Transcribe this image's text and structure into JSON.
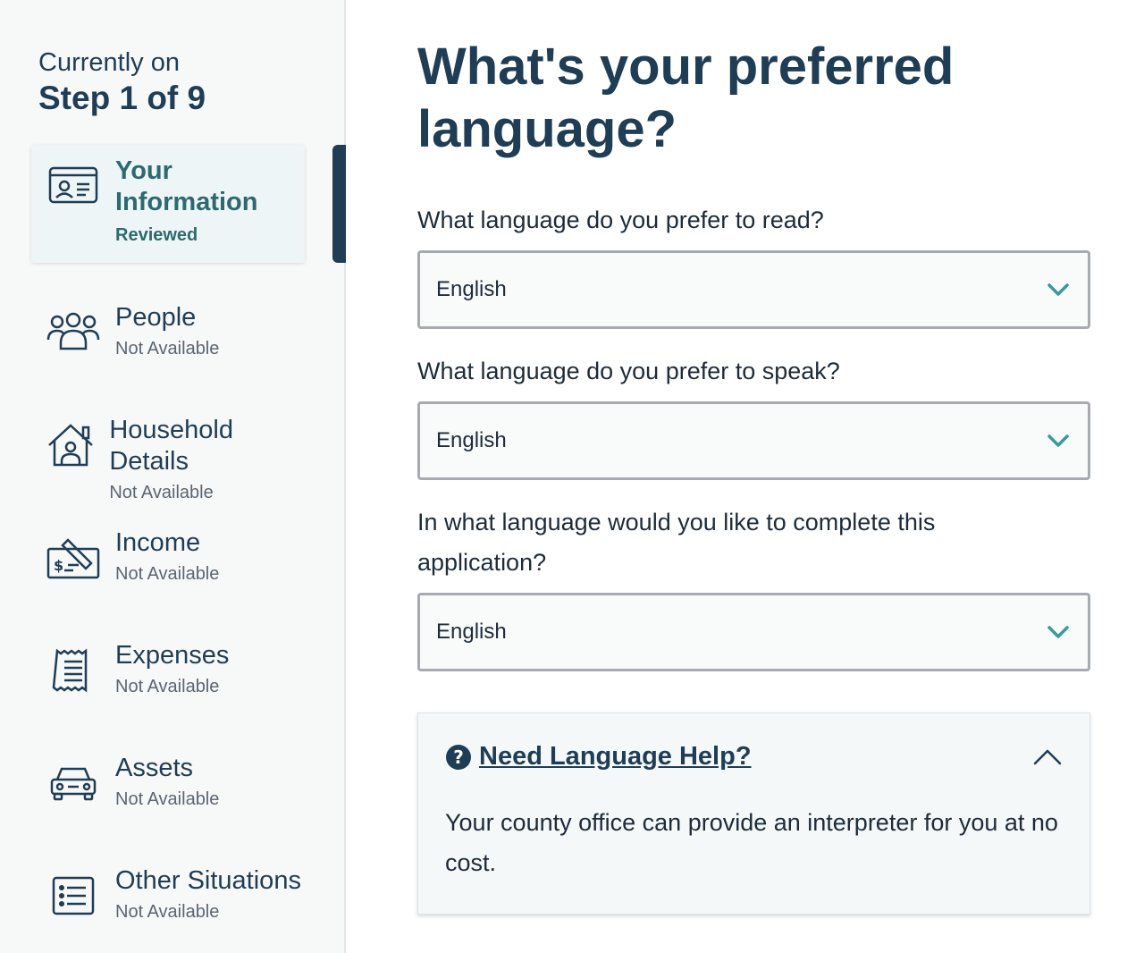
{
  "sidebar": {
    "step_prefix": "Currently on",
    "step_label": "Step 1 of 9",
    "items": [
      {
        "title_line1": "Your",
        "title_line2": "Information",
        "status": "Reviewed",
        "icon": "id-card-icon"
      },
      {
        "title": "People",
        "status": "Not Available",
        "icon": "people-icon"
      },
      {
        "title": "Household Details",
        "status": "Not Available",
        "icon": "house-icon"
      },
      {
        "title": "Income",
        "status": "Not Available",
        "icon": "check-money-icon"
      },
      {
        "title": "Expenses",
        "status": "Not Available",
        "icon": "receipt-icon"
      },
      {
        "title": "Assets",
        "status": "Not Available",
        "icon": "car-icon"
      },
      {
        "title": "Other Situations",
        "status": "Not Available",
        "icon": "list-icon"
      }
    ]
  },
  "main": {
    "title": "What's your preferred language?",
    "questions": [
      {
        "label": "What language do you prefer to read?",
        "value": "English"
      },
      {
        "label": "What language do you prefer to speak?",
        "value": "English"
      },
      {
        "label": "In what language would you like to complete this application?",
        "value": "English"
      }
    ],
    "help": {
      "link": "Need Language Help?",
      "body": "Your county office can provide an interpreter for you at no cost."
    }
  },
  "colors": {
    "brand_dark": "#1f3d55",
    "accent_teal": "#2d6a6f",
    "chevron_teal": "#3a9a9a"
  }
}
